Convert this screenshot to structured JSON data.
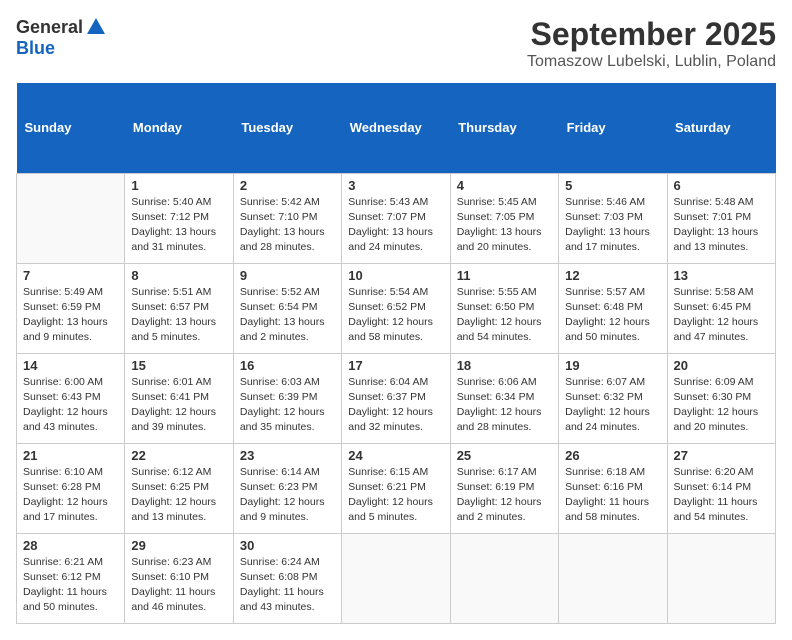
{
  "logo": {
    "general": "General",
    "blue": "Blue"
  },
  "title": "September 2025",
  "subtitle": "Tomaszow Lubelski, Lublin, Poland",
  "headers": [
    "Sunday",
    "Monday",
    "Tuesday",
    "Wednesday",
    "Thursday",
    "Friday",
    "Saturday"
  ],
  "weeks": [
    [
      {
        "day": "",
        "info": ""
      },
      {
        "day": "1",
        "info": "Sunrise: 5:40 AM\nSunset: 7:12 PM\nDaylight: 13 hours\nand 31 minutes."
      },
      {
        "day": "2",
        "info": "Sunrise: 5:42 AM\nSunset: 7:10 PM\nDaylight: 13 hours\nand 28 minutes."
      },
      {
        "day": "3",
        "info": "Sunrise: 5:43 AM\nSunset: 7:07 PM\nDaylight: 13 hours\nand 24 minutes."
      },
      {
        "day": "4",
        "info": "Sunrise: 5:45 AM\nSunset: 7:05 PM\nDaylight: 13 hours\nand 20 minutes."
      },
      {
        "day": "5",
        "info": "Sunrise: 5:46 AM\nSunset: 7:03 PM\nDaylight: 13 hours\nand 17 minutes."
      },
      {
        "day": "6",
        "info": "Sunrise: 5:48 AM\nSunset: 7:01 PM\nDaylight: 13 hours\nand 13 minutes."
      }
    ],
    [
      {
        "day": "7",
        "info": "Sunrise: 5:49 AM\nSunset: 6:59 PM\nDaylight: 13 hours\nand 9 minutes."
      },
      {
        "day": "8",
        "info": "Sunrise: 5:51 AM\nSunset: 6:57 PM\nDaylight: 13 hours\nand 5 minutes."
      },
      {
        "day": "9",
        "info": "Sunrise: 5:52 AM\nSunset: 6:54 PM\nDaylight: 13 hours\nand 2 minutes."
      },
      {
        "day": "10",
        "info": "Sunrise: 5:54 AM\nSunset: 6:52 PM\nDaylight: 12 hours\nand 58 minutes."
      },
      {
        "day": "11",
        "info": "Sunrise: 5:55 AM\nSunset: 6:50 PM\nDaylight: 12 hours\nand 54 minutes."
      },
      {
        "day": "12",
        "info": "Sunrise: 5:57 AM\nSunset: 6:48 PM\nDaylight: 12 hours\nand 50 minutes."
      },
      {
        "day": "13",
        "info": "Sunrise: 5:58 AM\nSunset: 6:45 PM\nDaylight: 12 hours\nand 47 minutes."
      }
    ],
    [
      {
        "day": "14",
        "info": "Sunrise: 6:00 AM\nSunset: 6:43 PM\nDaylight: 12 hours\nand 43 minutes."
      },
      {
        "day": "15",
        "info": "Sunrise: 6:01 AM\nSunset: 6:41 PM\nDaylight: 12 hours\nand 39 minutes."
      },
      {
        "day": "16",
        "info": "Sunrise: 6:03 AM\nSunset: 6:39 PM\nDaylight: 12 hours\nand 35 minutes."
      },
      {
        "day": "17",
        "info": "Sunrise: 6:04 AM\nSunset: 6:37 PM\nDaylight: 12 hours\nand 32 minutes."
      },
      {
        "day": "18",
        "info": "Sunrise: 6:06 AM\nSunset: 6:34 PM\nDaylight: 12 hours\nand 28 minutes."
      },
      {
        "day": "19",
        "info": "Sunrise: 6:07 AM\nSunset: 6:32 PM\nDaylight: 12 hours\nand 24 minutes."
      },
      {
        "day": "20",
        "info": "Sunrise: 6:09 AM\nSunset: 6:30 PM\nDaylight: 12 hours\nand 20 minutes."
      }
    ],
    [
      {
        "day": "21",
        "info": "Sunrise: 6:10 AM\nSunset: 6:28 PM\nDaylight: 12 hours\nand 17 minutes."
      },
      {
        "day": "22",
        "info": "Sunrise: 6:12 AM\nSunset: 6:25 PM\nDaylight: 12 hours\nand 13 minutes."
      },
      {
        "day": "23",
        "info": "Sunrise: 6:14 AM\nSunset: 6:23 PM\nDaylight: 12 hours\nand 9 minutes."
      },
      {
        "day": "24",
        "info": "Sunrise: 6:15 AM\nSunset: 6:21 PM\nDaylight: 12 hours\nand 5 minutes."
      },
      {
        "day": "25",
        "info": "Sunrise: 6:17 AM\nSunset: 6:19 PM\nDaylight: 12 hours\nand 2 minutes."
      },
      {
        "day": "26",
        "info": "Sunrise: 6:18 AM\nSunset: 6:16 PM\nDaylight: 11 hours\nand 58 minutes."
      },
      {
        "day": "27",
        "info": "Sunrise: 6:20 AM\nSunset: 6:14 PM\nDaylight: 11 hours\nand 54 minutes."
      }
    ],
    [
      {
        "day": "28",
        "info": "Sunrise: 6:21 AM\nSunset: 6:12 PM\nDaylight: 11 hours\nand 50 minutes."
      },
      {
        "day": "29",
        "info": "Sunrise: 6:23 AM\nSunset: 6:10 PM\nDaylight: 11 hours\nand 46 minutes."
      },
      {
        "day": "30",
        "info": "Sunrise: 6:24 AM\nSunset: 6:08 PM\nDaylight: 11 hours\nand 43 minutes."
      },
      {
        "day": "",
        "info": ""
      },
      {
        "day": "",
        "info": ""
      },
      {
        "day": "",
        "info": ""
      },
      {
        "day": "",
        "info": ""
      }
    ]
  ]
}
